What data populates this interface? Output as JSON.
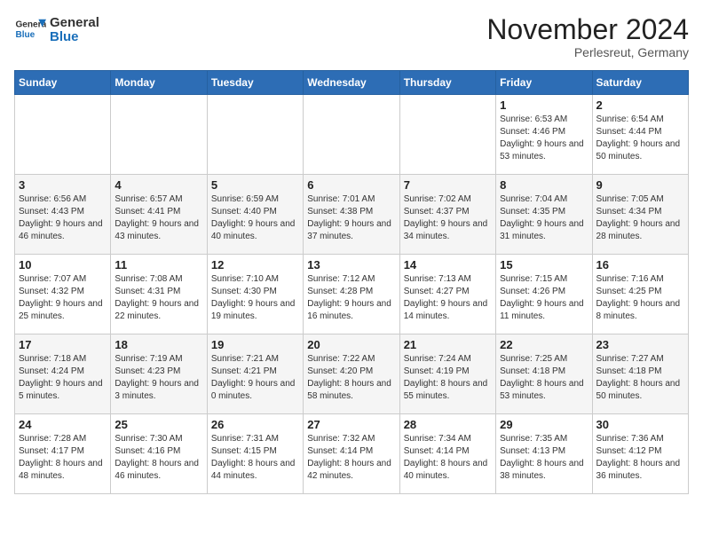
{
  "logo": {
    "line1": "General",
    "line2": "Blue"
  },
  "title": "November 2024",
  "location": "Perlesreut, Germany",
  "weekdays": [
    "Sunday",
    "Monday",
    "Tuesday",
    "Wednesday",
    "Thursday",
    "Friday",
    "Saturday"
  ],
  "weeks": [
    [
      {
        "day": "",
        "info": ""
      },
      {
        "day": "",
        "info": ""
      },
      {
        "day": "",
        "info": ""
      },
      {
        "day": "",
        "info": ""
      },
      {
        "day": "",
        "info": ""
      },
      {
        "day": "1",
        "info": "Sunrise: 6:53 AM\nSunset: 4:46 PM\nDaylight: 9 hours and 53 minutes."
      },
      {
        "day": "2",
        "info": "Sunrise: 6:54 AM\nSunset: 4:44 PM\nDaylight: 9 hours and 50 minutes."
      }
    ],
    [
      {
        "day": "3",
        "info": "Sunrise: 6:56 AM\nSunset: 4:43 PM\nDaylight: 9 hours and 46 minutes."
      },
      {
        "day": "4",
        "info": "Sunrise: 6:57 AM\nSunset: 4:41 PM\nDaylight: 9 hours and 43 minutes."
      },
      {
        "day": "5",
        "info": "Sunrise: 6:59 AM\nSunset: 4:40 PM\nDaylight: 9 hours and 40 minutes."
      },
      {
        "day": "6",
        "info": "Sunrise: 7:01 AM\nSunset: 4:38 PM\nDaylight: 9 hours and 37 minutes."
      },
      {
        "day": "7",
        "info": "Sunrise: 7:02 AM\nSunset: 4:37 PM\nDaylight: 9 hours and 34 minutes."
      },
      {
        "day": "8",
        "info": "Sunrise: 7:04 AM\nSunset: 4:35 PM\nDaylight: 9 hours and 31 minutes."
      },
      {
        "day": "9",
        "info": "Sunrise: 7:05 AM\nSunset: 4:34 PM\nDaylight: 9 hours and 28 minutes."
      }
    ],
    [
      {
        "day": "10",
        "info": "Sunrise: 7:07 AM\nSunset: 4:32 PM\nDaylight: 9 hours and 25 minutes."
      },
      {
        "day": "11",
        "info": "Sunrise: 7:08 AM\nSunset: 4:31 PM\nDaylight: 9 hours and 22 minutes."
      },
      {
        "day": "12",
        "info": "Sunrise: 7:10 AM\nSunset: 4:30 PM\nDaylight: 9 hours and 19 minutes."
      },
      {
        "day": "13",
        "info": "Sunrise: 7:12 AM\nSunset: 4:28 PM\nDaylight: 9 hours and 16 minutes."
      },
      {
        "day": "14",
        "info": "Sunrise: 7:13 AM\nSunset: 4:27 PM\nDaylight: 9 hours and 14 minutes."
      },
      {
        "day": "15",
        "info": "Sunrise: 7:15 AM\nSunset: 4:26 PM\nDaylight: 9 hours and 11 minutes."
      },
      {
        "day": "16",
        "info": "Sunrise: 7:16 AM\nSunset: 4:25 PM\nDaylight: 9 hours and 8 minutes."
      }
    ],
    [
      {
        "day": "17",
        "info": "Sunrise: 7:18 AM\nSunset: 4:24 PM\nDaylight: 9 hours and 5 minutes."
      },
      {
        "day": "18",
        "info": "Sunrise: 7:19 AM\nSunset: 4:23 PM\nDaylight: 9 hours and 3 minutes."
      },
      {
        "day": "19",
        "info": "Sunrise: 7:21 AM\nSunset: 4:21 PM\nDaylight: 9 hours and 0 minutes."
      },
      {
        "day": "20",
        "info": "Sunrise: 7:22 AM\nSunset: 4:20 PM\nDaylight: 8 hours and 58 minutes."
      },
      {
        "day": "21",
        "info": "Sunrise: 7:24 AM\nSunset: 4:19 PM\nDaylight: 8 hours and 55 minutes."
      },
      {
        "day": "22",
        "info": "Sunrise: 7:25 AM\nSunset: 4:18 PM\nDaylight: 8 hours and 53 minutes."
      },
      {
        "day": "23",
        "info": "Sunrise: 7:27 AM\nSunset: 4:18 PM\nDaylight: 8 hours and 50 minutes."
      }
    ],
    [
      {
        "day": "24",
        "info": "Sunrise: 7:28 AM\nSunset: 4:17 PM\nDaylight: 8 hours and 48 minutes."
      },
      {
        "day": "25",
        "info": "Sunrise: 7:30 AM\nSunset: 4:16 PM\nDaylight: 8 hours and 46 minutes."
      },
      {
        "day": "26",
        "info": "Sunrise: 7:31 AM\nSunset: 4:15 PM\nDaylight: 8 hours and 44 minutes."
      },
      {
        "day": "27",
        "info": "Sunrise: 7:32 AM\nSunset: 4:14 PM\nDaylight: 8 hours and 42 minutes."
      },
      {
        "day": "28",
        "info": "Sunrise: 7:34 AM\nSunset: 4:14 PM\nDaylight: 8 hours and 40 minutes."
      },
      {
        "day": "29",
        "info": "Sunrise: 7:35 AM\nSunset: 4:13 PM\nDaylight: 8 hours and 38 minutes."
      },
      {
        "day": "30",
        "info": "Sunrise: 7:36 AM\nSunset: 4:12 PM\nDaylight: 8 hours and 36 minutes."
      }
    ]
  ]
}
